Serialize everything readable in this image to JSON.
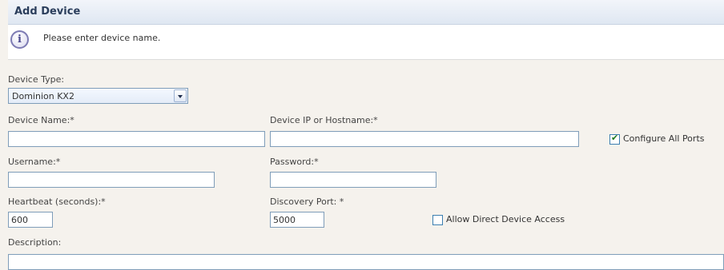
{
  "header": {
    "title": "Add Device"
  },
  "info": {
    "message": "Please enter device name."
  },
  "form": {
    "device_type": {
      "label": "Device Type:",
      "value": "Dominion KX2"
    },
    "device_name": {
      "label": "Device Name:*",
      "value": ""
    },
    "device_ip": {
      "label": "Device IP or Hostname:*",
      "value": ""
    },
    "configure_all_ports": {
      "label": "Configure All Ports",
      "checked": true
    },
    "username": {
      "label": "Username:*",
      "value": ""
    },
    "password": {
      "label": "Password:*",
      "value": ""
    },
    "heartbeat": {
      "label": "Heartbeat (seconds):*",
      "value": "600"
    },
    "discovery_port": {
      "label": "Discovery Port: *",
      "value": "5000"
    },
    "allow_direct_access": {
      "label": "Allow Direct Device Access",
      "checked": false
    },
    "description": {
      "label": "Description:",
      "value": ""
    }
  }
}
